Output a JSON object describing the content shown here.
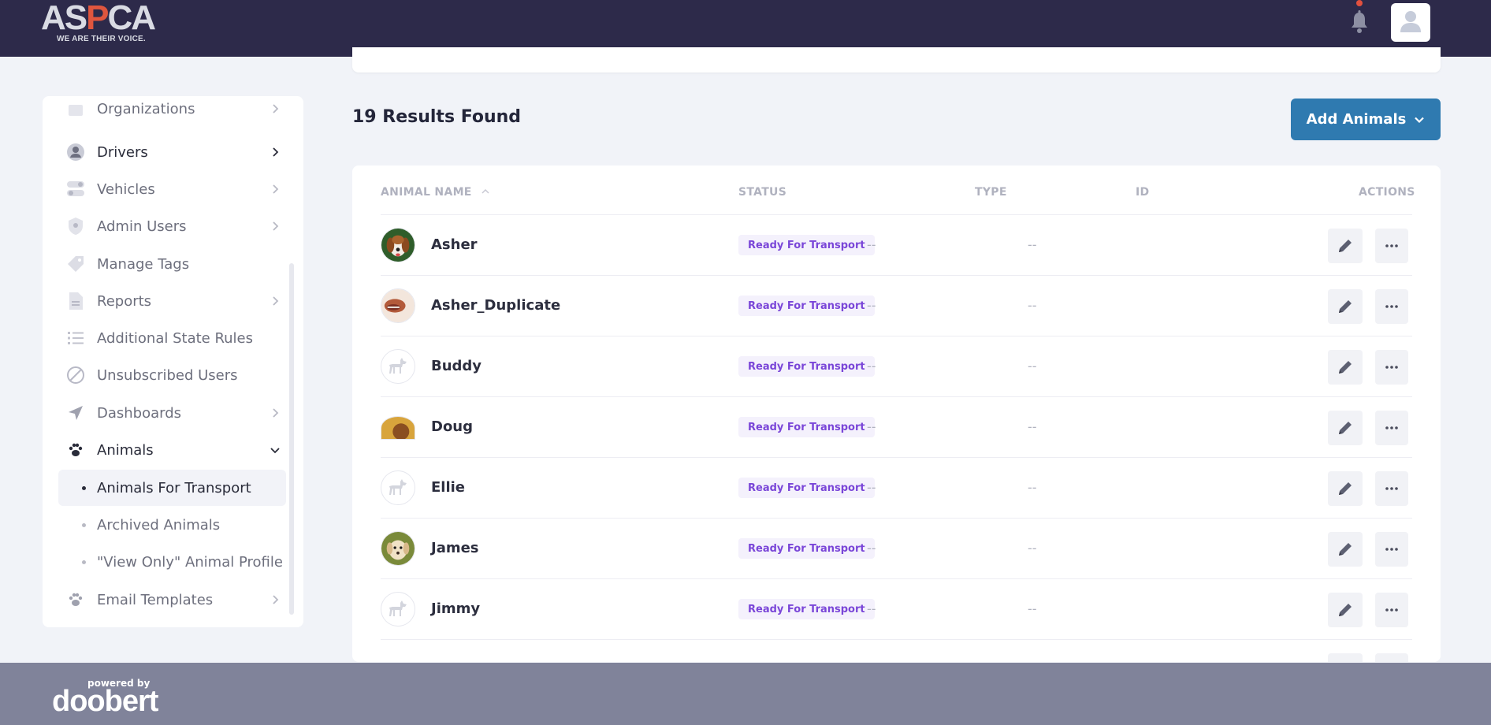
{
  "header": {
    "logo_text": "ASPCA",
    "logo_tagline": "WE ARE THEIR VOICE.",
    "icons": {
      "notification": "bell-icon",
      "profile": "user-avatar-icon"
    }
  },
  "sidebar": {
    "items": [
      {
        "label": "Organizations",
        "icon": "building-icon"
      },
      {
        "label": "Drivers",
        "icon": "driver-avatar-icon"
      },
      {
        "label": "Vehicles",
        "icon": "toggle-icon"
      },
      {
        "label": "Admin Users",
        "icon": "shield-icon"
      },
      {
        "label": "Manage Tags",
        "icon": "tag-icon"
      },
      {
        "label": "Reports",
        "icon": "document-icon"
      },
      {
        "label": "Additional State Rules",
        "icon": "list-icon"
      },
      {
        "label": "Unsubscribed Users",
        "icon": "block-icon"
      },
      {
        "label": "Dashboards",
        "icon": "navigation-arrow-icon"
      },
      {
        "label": "Animals",
        "icon": "paw-icon"
      },
      {
        "label": "Email Templates",
        "icon": "paw-icon"
      }
    ],
    "sub_items": [
      {
        "label": "Animals For Transport",
        "active": true
      },
      {
        "label": "Archived Animals",
        "active": false
      },
      {
        "label": "\"View Only\" Animal Profile",
        "active": false
      }
    ]
  },
  "results": {
    "title": "19 Results Found",
    "add_button_label": "Add Animals"
  },
  "table": {
    "columns": [
      "ANIMAL NAME",
      "STATUS",
      "TYPE",
      "ID",
      "ACTIONS"
    ],
    "sort_column": "ANIMAL NAME",
    "rows": [
      {
        "name": "Asher",
        "status": "Ready For Transport",
        "type": "--",
        "id": "--",
        "avatar": "photo-beagle"
      },
      {
        "name": "Asher_Duplicate",
        "status": "Ready For Transport",
        "type": "--",
        "id": "--",
        "avatar": "photo-dog"
      },
      {
        "name": "Buddy",
        "status": "Ready For Transport",
        "type": "--",
        "id": "--",
        "avatar": "placeholder-dog-icon"
      },
      {
        "name": "Doug",
        "status": "Ready For Transport",
        "type": "--",
        "id": "--",
        "avatar": "photo-brown"
      },
      {
        "name": "Ellie",
        "status": "Ready For Transport",
        "type": "--",
        "id": "--",
        "avatar": "placeholder-dog-icon"
      },
      {
        "name": "James",
        "status": "Ready For Transport",
        "type": "--",
        "id": "--",
        "avatar": "photo-puppy"
      },
      {
        "name": "Jimmy",
        "status": "Ready For Transport",
        "type": "--",
        "id": "--",
        "avatar": "placeholder-dog-icon"
      }
    ]
  },
  "footer": {
    "powered_by": "powered by",
    "brand": "doobert"
  },
  "colors": {
    "topbar": "#2d2a4a",
    "primary_button": "#2f7ab0",
    "badge_text": "#7a46d8",
    "badge_bg": "#f4f1fc",
    "footer": "#80839a"
  }
}
